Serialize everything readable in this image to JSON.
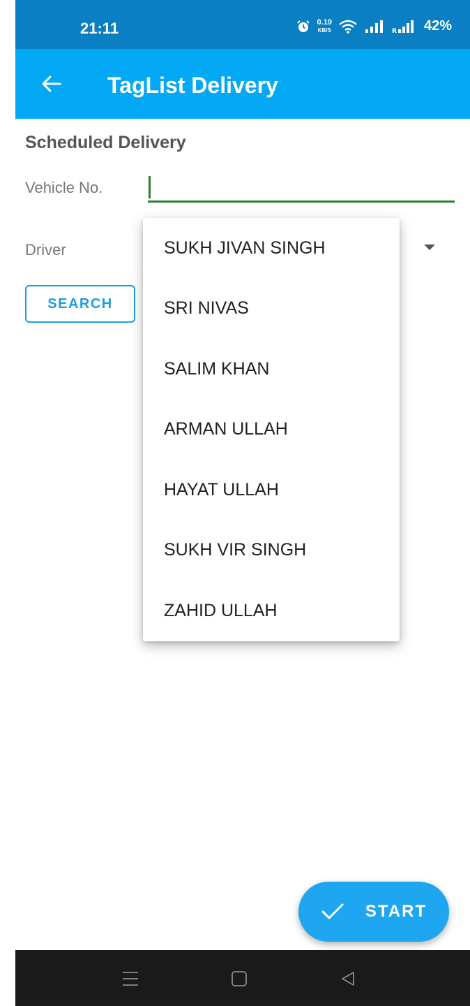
{
  "status_bar": {
    "time": "21:11",
    "net_speed_value": "0.19",
    "net_speed_unit": "KB/S",
    "battery": "42%",
    "icons": [
      "alarm-icon",
      "wifi-icon",
      "signal-icon",
      "signal-roaming-icon"
    ]
  },
  "app_bar": {
    "title": "TagList Delivery",
    "back_icon": "arrow-left-icon"
  },
  "form": {
    "section_title": "Scheduled Delivery",
    "vehicle_label": "Vehicle No.",
    "vehicle_value": "",
    "driver_label": "Driver",
    "search_label": "SEARCH"
  },
  "driver_dropdown": {
    "options": [
      "SUKH JIVAN SINGH",
      "SRI NIVAS",
      "SALIM KHAN",
      "ARMAN ULLAH",
      "HAYAT ULLAH",
      "SUKH VIR SINGH",
      "ZAHID ULLAH"
    ]
  },
  "fab": {
    "label": "START",
    "icon": "check-icon"
  },
  "nav_bar": {
    "icons": [
      "menu-icon",
      "home-icon",
      "back-icon"
    ]
  },
  "colors": {
    "status_bar": "#0a7fc3",
    "app_bar": "#03a9f4",
    "accent": "#1a9ee0",
    "input_underline": "#2e7d32",
    "nav_bar": "#1a1a1a"
  }
}
